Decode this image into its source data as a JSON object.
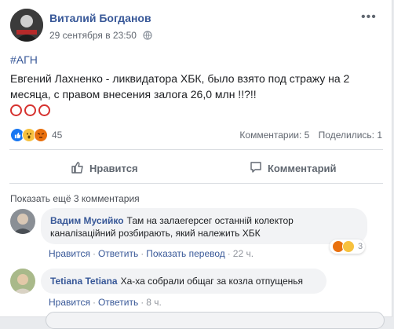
{
  "post": {
    "author": "Виталий Богданов",
    "time": "29 сентября в 23:50",
    "hashtag": "#АГН",
    "text": "Евгений Лахненко - ликвидатора ХБК, было взято под стражу на 2 месяца, с правом внесения залога 26,0 млн !!?!!",
    "reaction_count": "45",
    "comments_stat": "Комментарии: 5",
    "shares_stat": "Поделились: 1",
    "like_label": "Нравится",
    "comment_label": "Комментарий",
    "reaction_types": [
      "like-icon",
      "wow-icon",
      "angry-icon"
    ]
  },
  "comments": {
    "show_more": "Показать ещё 3 комментария",
    "items": [
      {
        "author": "Вадим Мусийко",
        "text": "Там на залаегерсег останній колектор каналізаційний розбирають, який належить ХБК",
        "like": "Нравится",
        "reply": "Ответить",
        "translate": "Показать перевод",
        "time": "22 ч.",
        "reaction_count": "3"
      },
      {
        "author": "Tetiana Tetiana",
        "text": "Ха-ха собрали общаг за козла отпущенья",
        "like": "Нравится",
        "reply": "Ответить",
        "time": "8 ч."
      }
    ]
  },
  "colors": {
    "link": "#385898",
    "like": "#1877f2",
    "angry": "#e9710f",
    "wow": "#f7c13e",
    "ring": "#d6322f"
  }
}
